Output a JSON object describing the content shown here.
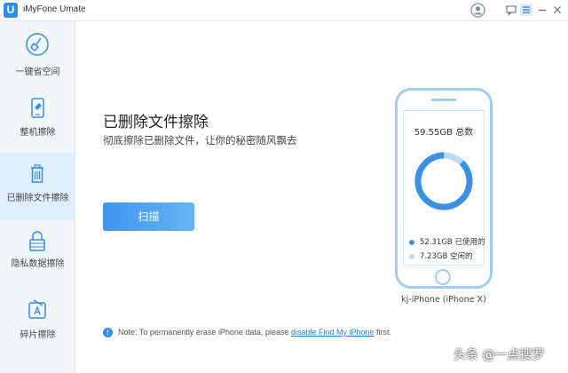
{
  "app": {
    "logo_letter": "U",
    "title": "iMyFone Umate"
  },
  "titlebar": {
    "icons": [
      "account-icon",
      "feedback-icon",
      "menu-icon",
      "minimize-icon",
      "close-icon"
    ]
  },
  "sidebar": {
    "items": [
      {
        "label": "一键省空间",
        "icon": "broom-icon",
        "active": false
      },
      {
        "label": "整机擦除",
        "icon": "phone-erase-icon",
        "active": false
      },
      {
        "label": "已删除文件擦除",
        "icon": "trash-icon",
        "active": true
      },
      {
        "label": "隐私数据擦除",
        "icon": "lock-icon",
        "active": false
      },
      {
        "label": "碎片擦除",
        "icon": "app-store-icon",
        "active": false
      }
    ]
  },
  "main": {
    "title": "已删除文件擦除",
    "subtitle": "彻底擦除已删除文件，让你的秘密随风飘去",
    "scan_button": "扫描"
  },
  "device": {
    "total": "59.55GB 总数",
    "used": "52.31GB 已使用的",
    "free": "7.23GB 空闲的",
    "used_fraction": 0.878,
    "name": "kj-iPhone (iPhone X)",
    "colors": {
      "used": "#3b90e2",
      "free": "#bcdaf4"
    }
  },
  "note": {
    "text_before": "Note: To permanently erase iPhone data, please ",
    "link": "disable Find My iPhone",
    "text_after": " first."
  },
  "watermark": "头条 @一点搜罗"
}
